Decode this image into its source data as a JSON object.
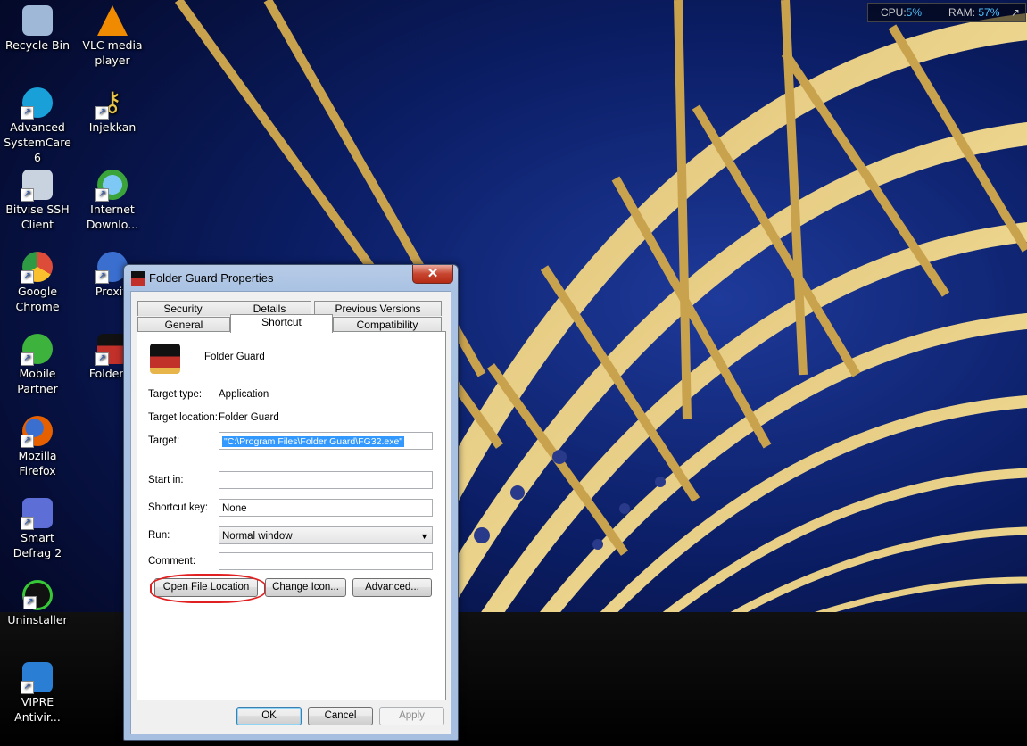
{
  "desktop": {
    "icons": [
      {
        "label": "Recycle Bin",
        "icon": "recycle-bin-icon",
        "color": "#9fb8d8"
      },
      {
        "label": "Advanced SystemCare 6",
        "icon": "advanced-systemcare-icon",
        "color": "#1aa0d8"
      },
      {
        "label": "Bitvise SSH Client",
        "icon": "bitvise-icon",
        "color": "#c9d3df"
      },
      {
        "label": "Google Chrome",
        "icon": "chrome-icon",
        "color": "#dd4b39"
      },
      {
        "label": "Mobile Partner",
        "icon": "mobile-partner-icon",
        "color": "#3db33d"
      },
      {
        "label": "Mozilla Firefox",
        "icon": "firefox-icon",
        "color": "#e66000"
      },
      {
        "label": "Smart Defrag 2",
        "icon": "smart-defrag-icon",
        "color": "#5d6fd6"
      },
      {
        "label": "Uninstaller",
        "icon": "uninstaller-icon",
        "color": "#37c837"
      },
      {
        "label": "VIPRE Antivir...",
        "icon": "vipre-icon",
        "color": "#2a7fd4"
      },
      {
        "label": "VLC media player",
        "icon": "vlc-icon",
        "color": "#f08a00"
      },
      {
        "label": "Injekkan",
        "icon": "key-icon",
        "color": "#e6c34a"
      },
      {
        "label": "Internet Downlo...",
        "icon": "internet-download-icon",
        "color": "#3aa33a"
      },
      {
        "label": "Proxifi",
        "icon": "proxifier-icon",
        "color": "#3a6fd0"
      },
      {
        "label": "Folder G",
        "icon": "folder-guard-icon",
        "color": "#c2302a"
      }
    ]
  },
  "sysmon": {
    "cpu_label": "CPU:",
    "cpu_value": "5%",
    "ram_label": "RAM:",
    "ram_value": "57%",
    "arrow": "↗"
  },
  "dialog": {
    "title": "Folder Guard Properties",
    "close": "✕",
    "tabs_row1": [
      "Security",
      "Details",
      "Previous Versions"
    ],
    "tabs_row2": [
      "General",
      "Shortcut",
      "Compatibility"
    ],
    "active_tab": "Shortcut",
    "app_name": "Folder Guard",
    "target_type_label": "Target type:",
    "target_type_value": "Application",
    "target_location_label": "Target location:",
    "target_location_value": "Folder Guard",
    "target_label": "Target:",
    "target_value": "\"C:\\Program Files\\Folder Guard\\FG32.exe\"",
    "start_in_label": "Start in:",
    "start_in_value": "",
    "shortcut_key_label": "Shortcut key:",
    "shortcut_key_value": "None",
    "run_label": "Run:",
    "run_value": "Normal window",
    "comment_label": "Comment:",
    "comment_value": "",
    "open_file_location": "Open File Location",
    "change_icon": "Change Icon...",
    "advanced": "Advanced...",
    "ok": "OK",
    "cancel": "Cancel",
    "apply": "Apply"
  }
}
